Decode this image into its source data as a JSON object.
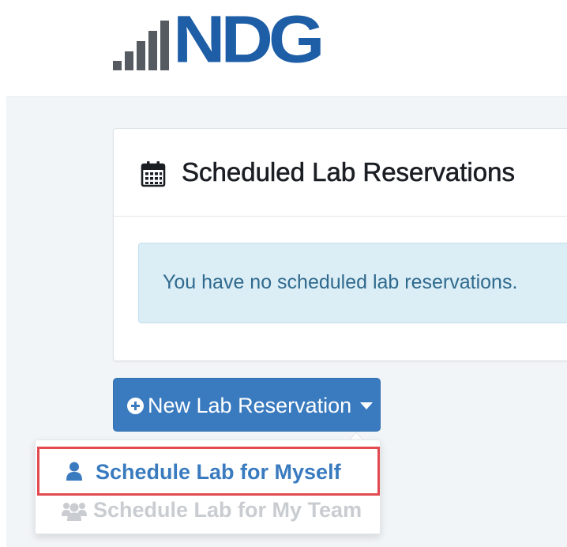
{
  "logo": {
    "text": "NDG",
    "color": "#1d5ea6",
    "bars_color": "#555b61"
  },
  "panel": {
    "title": "Scheduled Lab Reservations",
    "title_icon": "calendar-icon",
    "alert": "You have no scheduled lab reservations."
  },
  "new_reservation": {
    "label": "New Lab Reservation",
    "icon": "plus-circle-icon",
    "caret": "caret-down-icon",
    "color": "#3a7bbf"
  },
  "menu": {
    "items": [
      {
        "label": "Schedule Lab for Myself",
        "icon": "user-icon",
        "state": "highlighted",
        "highlight_color": "#e24a4f"
      },
      {
        "label": "Schedule Lab for My Team",
        "icon": "users-icon",
        "state": "disabled"
      }
    ]
  }
}
